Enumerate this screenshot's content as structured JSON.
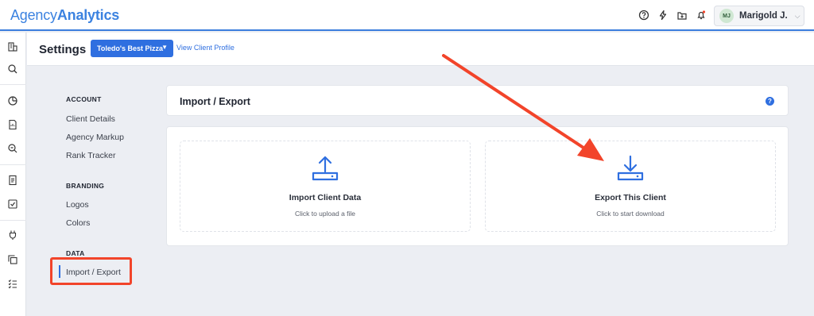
{
  "app": {
    "logo_part1": "Agency",
    "logo_part2": "Analytics"
  },
  "topbar": {
    "icons": [
      "help-icon",
      "bolt-icon",
      "download-tray-icon",
      "bell-icon"
    ],
    "user_initials": "MJ",
    "user_name": "Marigold J."
  },
  "header": {
    "title": "Settings",
    "client_select": "Toledo's Best Pizza",
    "view_profile": "View Client Profile"
  },
  "nav": {
    "sections": [
      {
        "label": "ACCOUNT",
        "items": [
          "Client Details",
          "Agency Markup",
          "Rank Tracker"
        ]
      },
      {
        "label": "BRANDING",
        "items": [
          "Logos",
          "Colors"
        ]
      },
      {
        "label": "DATA",
        "items": [
          "Import / Export"
        ]
      }
    ]
  },
  "card": {
    "title": "Import / Export",
    "help": "?"
  },
  "tiles": {
    "import": {
      "title": "Import Client Data",
      "subtitle": "Click to upload a file"
    },
    "export": {
      "title": "Export This Client",
      "subtitle": "Click to start download"
    }
  },
  "colors": {
    "accent": "#2f6fe0",
    "annotation": "#f2442a"
  }
}
